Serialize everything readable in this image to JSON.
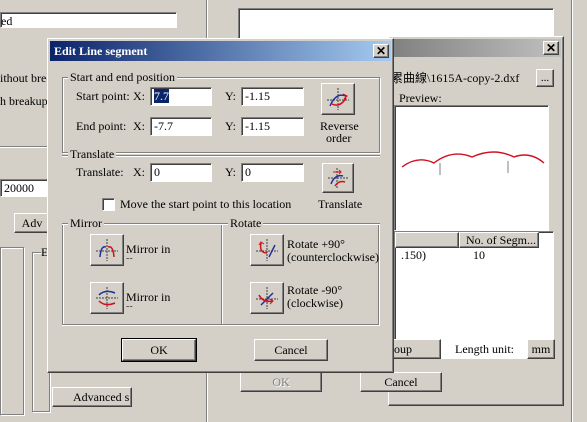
{
  "background_left": {
    "field_top_value": "ed",
    "without_break_text": "ithout bree",
    "breakup_text": "h breakup",
    "value_field": "20000",
    "adv_button": "Adv",
    "group_e_label": "E",
    "advanced_button": "Advanced s"
  },
  "background_right": {
    "file_path": "累曲線\\1615A-copy-2.dxf",
    "browse_button": "...",
    "preview_label": "Preview:",
    "list_headers": [
      "",
      "No. of Segm..."
    ],
    "list_row": [
      ".150)",
      "10"
    ],
    "group_button": "oup",
    "length_unit_label": "Length unit:",
    "length_unit_value": "mm",
    "ok_button": "OK",
    "cancel_button": "Cancel"
  },
  "dialog": {
    "title": "Edit Line segment",
    "start_end_group": "Start and end position",
    "start_point_label": "Start point:",
    "end_point_label": "End point:",
    "x_label": "X:",
    "y_label": "Y:",
    "start_x": "7.7",
    "start_y": "-1.15",
    "end_x": "-7.7",
    "end_y": "-1.15",
    "reverse_label_1": "Reverse",
    "reverse_label_2": "order",
    "translate_group": "Translate",
    "translate_label": "Translate:",
    "translate_x": "0",
    "translate_y": "0",
    "move_start_checkbox": "Move the start point to this location",
    "translate_button_label": "Translate",
    "mirror_group": "Mirror",
    "mirror_1": "Mirror in",
    "mirror_2": "Mirror in",
    "mirror_suffix": "--",
    "rotate_group": "Rotate",
    "rotate_ccw_1": "Rotate +90°",
    "rotate_ccw_2": "(counterclockwise)",
    "rotate_cw_1": "Rotate -90°",
    "rotate_cw_2": "(clockwise)",
    "ok_button": "OK",
    "cancel_button": "Cancel"
  },
  "colors": {
    "face": "#d4d0c8",
    "title_active": "#0a246a",
    "curve": "#d01020"
  }
}
